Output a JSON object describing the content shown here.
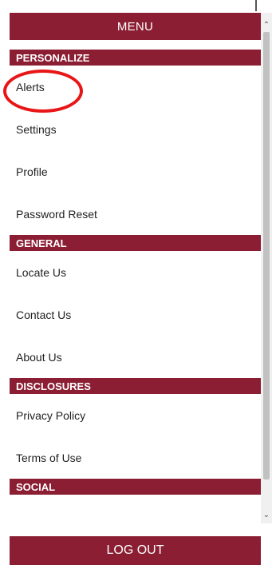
{
  "theme": {
    "accent": "#8b1e33",
    "highlight": "#e81616"
  },
  "menu": {
    "title": "MENU",
    "sections": [
      {
        "title": "PERSONALIZE",
        "items": [
          "Alerts",
          "Settings",
          "Profile",
          "Password Reset"
        ]
      },
      {
        "title": "GENERAL",
        "items": [
          "Locate Us",
          "Contact Us",
          "About Us"
        ]
      },
      {
        "title": "DISCLOSURES",
        "items": [
          "Privacy Policy",
          "Terms of Use"
        ]
      },
      {
        "title": "SOCIAL",
        "items": []
      }
    ]
  },
  "scrollbar": {
    "up_icon": "chevron-up-icon",
    "down_icon": "chevron-down-icon"
  },
  "annotation": {
    "target": "Alerts"
  },
  "logout": {
    "label": "LOG OUT"
  }
}
